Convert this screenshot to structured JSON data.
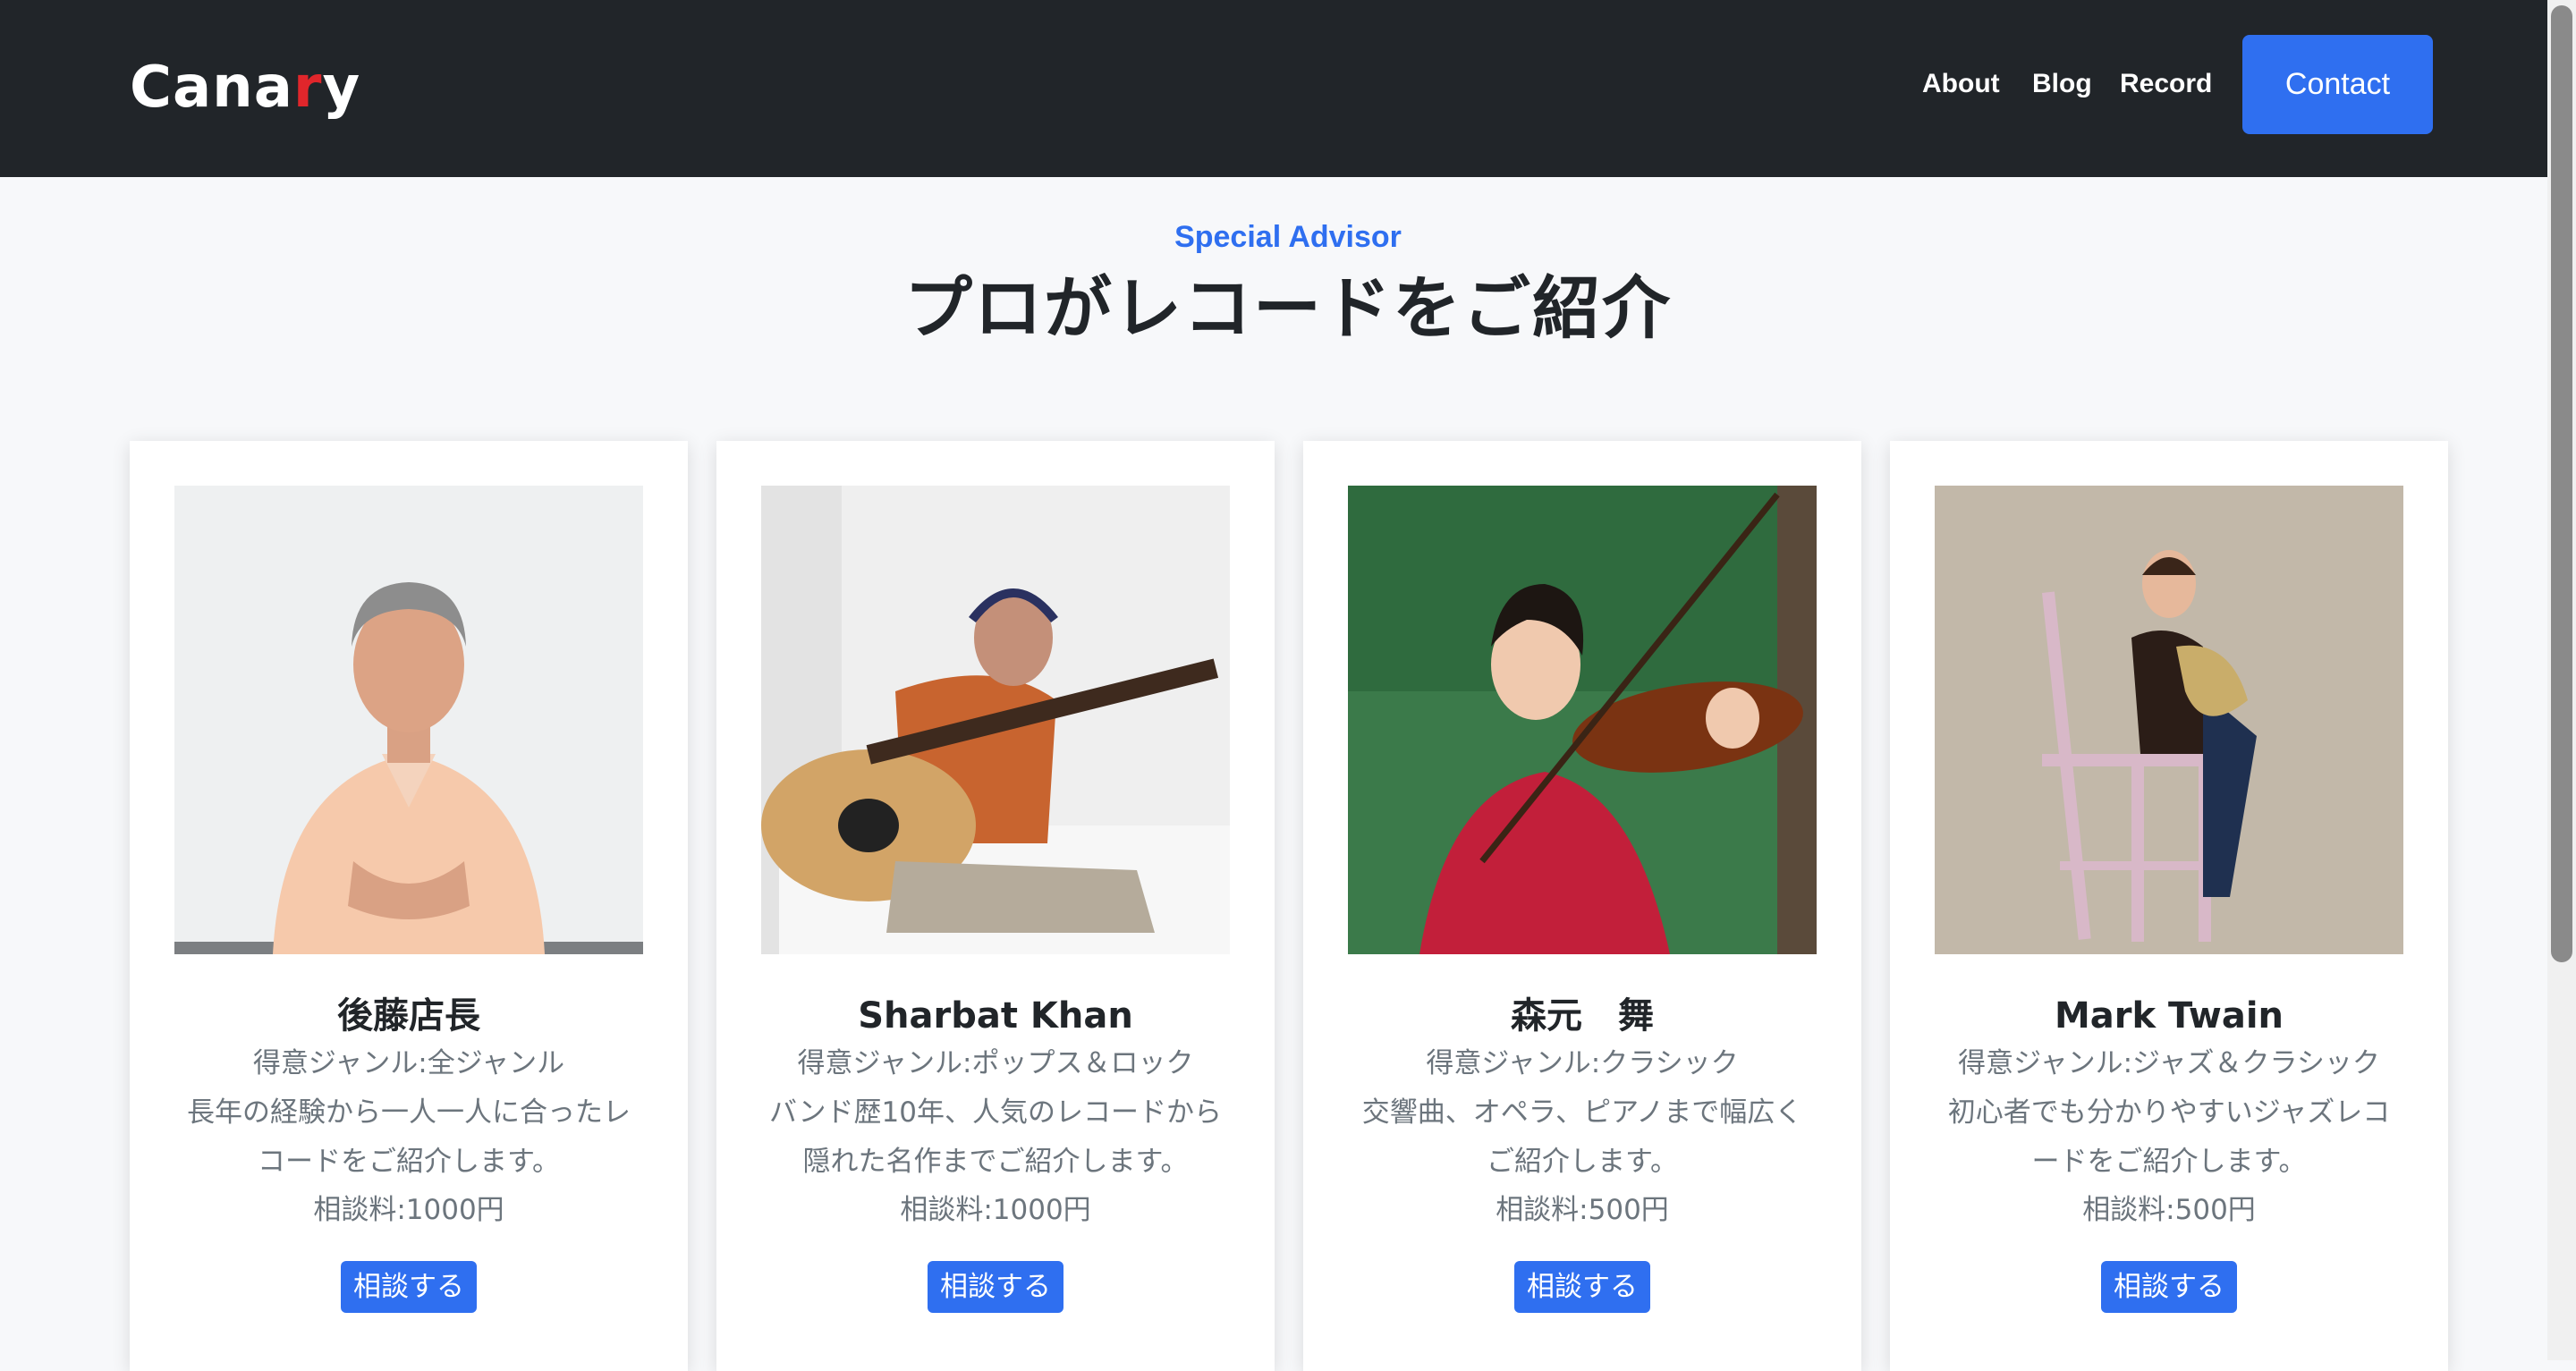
{
  "navbar": {
    "logo_prefix": "Cana",
    "logo_accent": "r",
    "logo_suffix": "y",
    "links": [
      "About",
      "Blog",
      "Record"
    ],
    "contact_label": "Contact"
  },
  "section": {
    "eyebrow": "Special Advisor",
    "title": "プロがレコードをご紹介"
  },
  "advisors": [
    {
      "name": "後藤店長",
      "genre": "得意ジャンル:全ジャンル",
      "description": "長年の経験から一人一人に合ったレコードをご紹介します。",
      "fee": "相談料:1000円",
      "button": "相談する"
    },
    {
      "name": "Sharbat Khan",
      "genre": "得意ジャンル:ポップス＆ロック",
      "description": "バンド歴10年、人気のレコードから隠れた名作までご紹介します。",
      "fee": "相談料:1000円",
      "button": "相談する"
    },
    {
      "name": "森元　舞",
      "genre": "得意ジャンル:クラシック",
      "description": "交響曲、オペラ、ピアノまで幅広くご紹介します。",
      "fee": "相談料:500円",
      "button": "相談する"
    },
    {
      "name": "Mark Twain",
      "genre": "得意ジャンル:ジャズ＆クラシック",
      "description": "初心者でも分かりやすいジャズレコードをご紹介します。",
      "fee": "相談料:500円",
      "button": "相談する"
    }
  ],
  "colors": {
    "nav_bg": "#212529",
    "accent_blue": "#2f6ff0",
    "logo_accent_red": "#e0262b",
    "page_bg": "#f7f8fa"
  }
}
